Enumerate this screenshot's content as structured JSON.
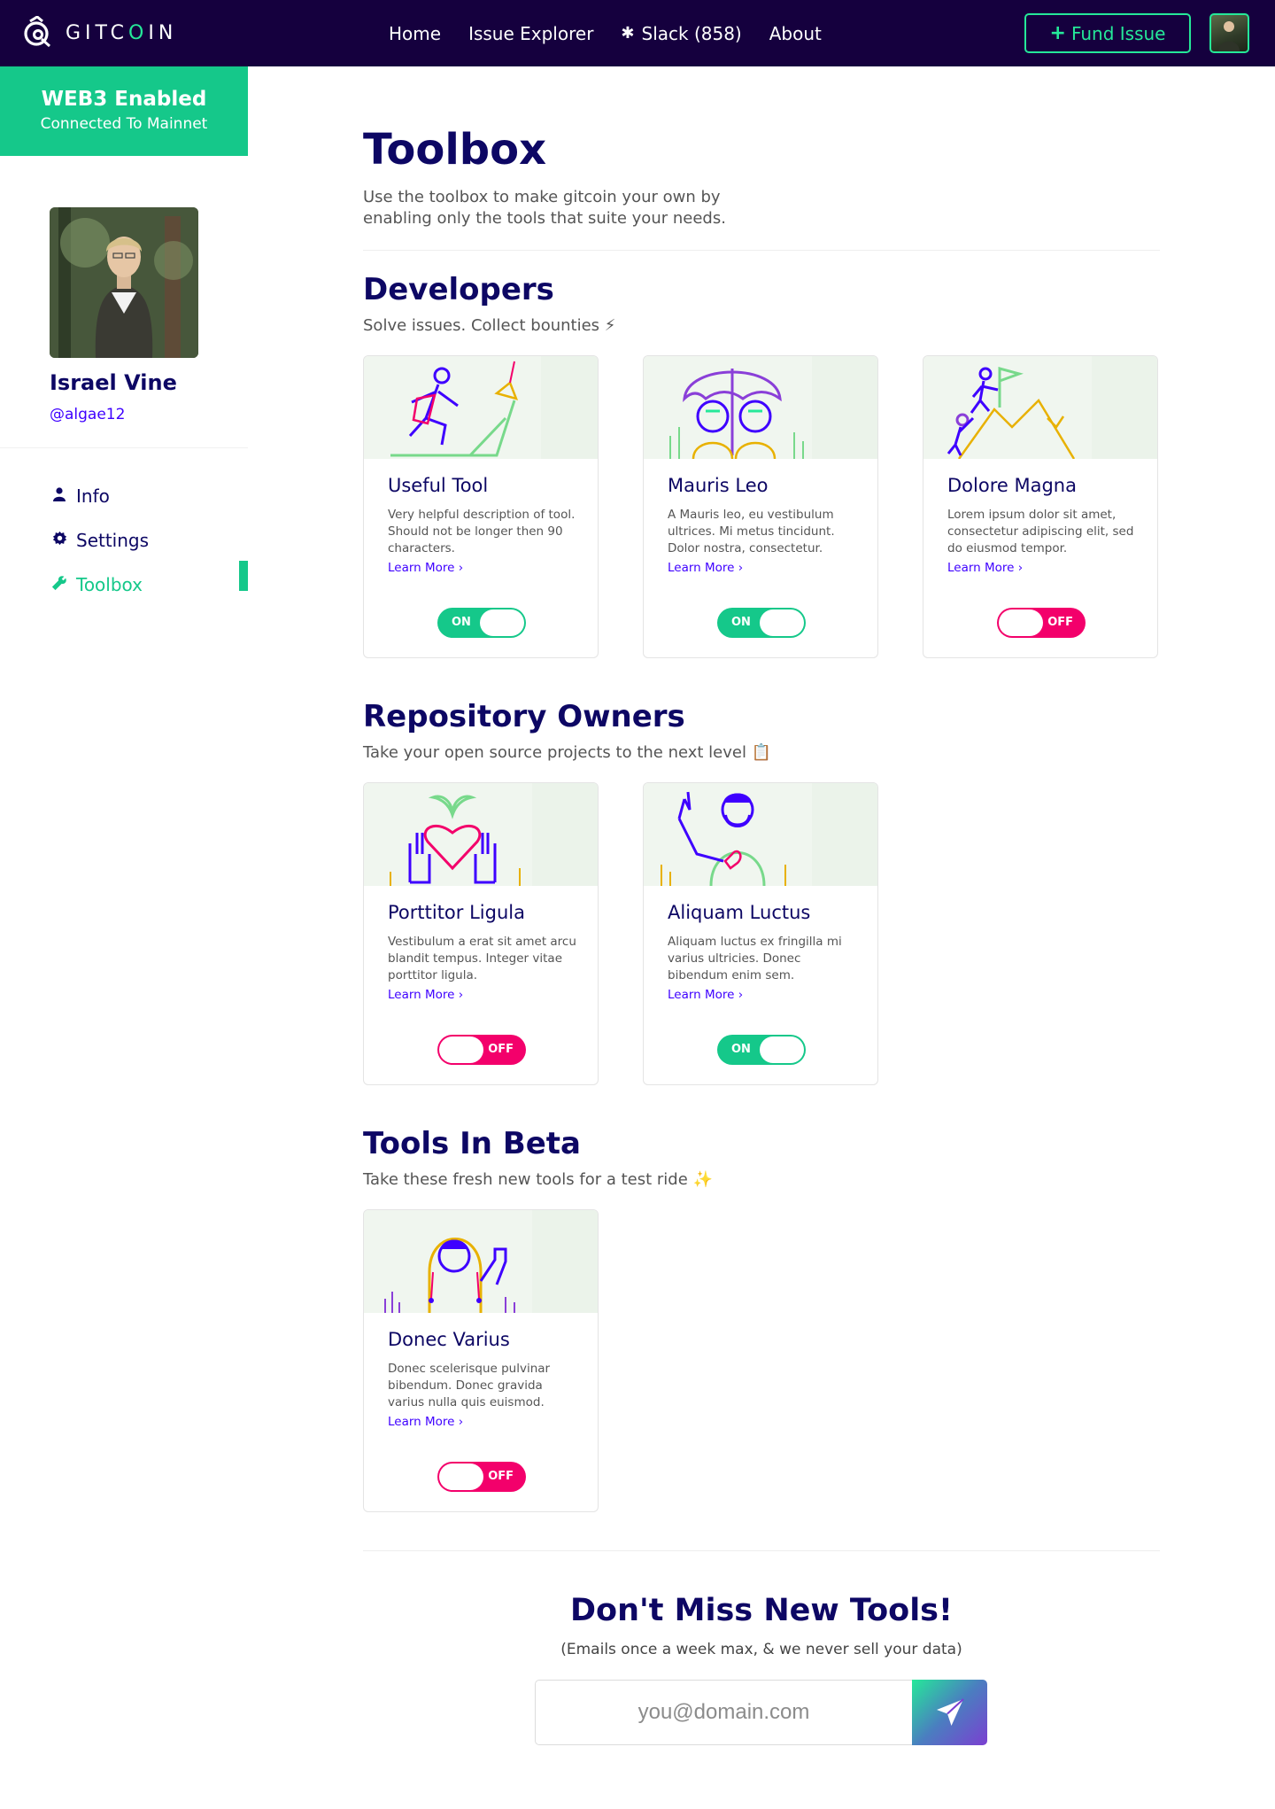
{
  "nav": {
    "logo_text_a": "GITC",
    "logo_text_o": "O",
    "logo_text_b": "IN",
    "links": [
      {
        "label": "Home",
        "icon": ""
      },
      {
        "label": "Issue Explorer",
        "icon": ""
      },
      {
        "label": "Slack (858)",
        "icon": "slack-icon"
      },
      {
        "label": "About",
        "icon": ""
      }
    ],
    "fund_label": "Fund Issue",
    "fund_icon": "plus-icon"
  },
  "sidebar": {
    "web3_title": "WEB3 Enabled",
    "web3_sub": "Connected To Mainnet",
    "name": "Israel Vine",
    "handle": "@algae12",
    "menu": [
      {
        "label": "Info",
        "icon": "user-icon",
        "active": false
      },
      {
        "label": "Settings",
        "icon": "gear-icon",
        "active": false
      },
      {
        "label": "Toolbox",
        "icon": "wrench-icon",
        "active": true
      }
    ]
  },
  "main": {
    "title": "Toolbox",
    "description": "Use the toolbox to make gitcoin your own by enabling only the tools that suite your needs.",
    "learn_more": "Learn More ›",
    "sections": [
      {
        "title": "Developers",
        "subtitle": "Solve issues. Collect bounties ⚡",
        "tools": [
          {
            "name": "Useful Tool",
            "description": "Very helpful description of tool. Should not be longer then 90 characters.",
            "state": "ON"
          },
          {
            "name": "Mauris Leo",
            "description": "A Mauris leo, eu vestibulum ultrices. Mi metus tincidunt. Dolor nostra, consectetur.",
            "state": "ON"
          },
          {
            "name": "Dolore Magna",
            "description": "Lorem ipsum dolor sit amet, consectetur adipiscing elit, sed do eiusmod tempor.",
            "state": "OFF"
          }
        ]
      },
      {
        "title": "Repository Owners",
        "subtitle": "Take your open source projects to the next level 📋",
        "tools": [
          {
            "name": "Porttitor Ligula",
            "description": "Vestibulum a erat sit amet arcu blandit tempus. Integer vitae porttitor ligula.",
            "state": "OFF"
          },
          {
            "name": "Aliquam Luctus",
            "description": "Aliquam luctus ex fringilla mi varius ultricies. Donec bibendum enim sem.",
            "state": "ON"
          }
        ]
      },
      {
        "title": "Tools In Beta",
        "subtitle": "Take these fresh new tools for a test ride ✨",
        "tools": [
          {
            "name": "Donec Varius",
            "description": "Donec scelerisque pulvinar bibendum. Donec gravida varius nulla quis euismod.",
            "state": "OFF"
          }
        ]
      }
    ],
    "newsletter": {
      "title": "Don't Miss New Tools!",
      "subtitle": "(Emails once a week max, & we never sell your data)",
      "placeholder": "you@domain.com",
      "send_icon": "paper-plane-icon"
    }
  },
  "colors": {
    "nav_bg": "#15003e",
    "accent_green": "#15c88a",
    "toggle_off": "#f3006b",
    "link": "#3e00ff",
    "heading": "#0d0764"
  }
}
